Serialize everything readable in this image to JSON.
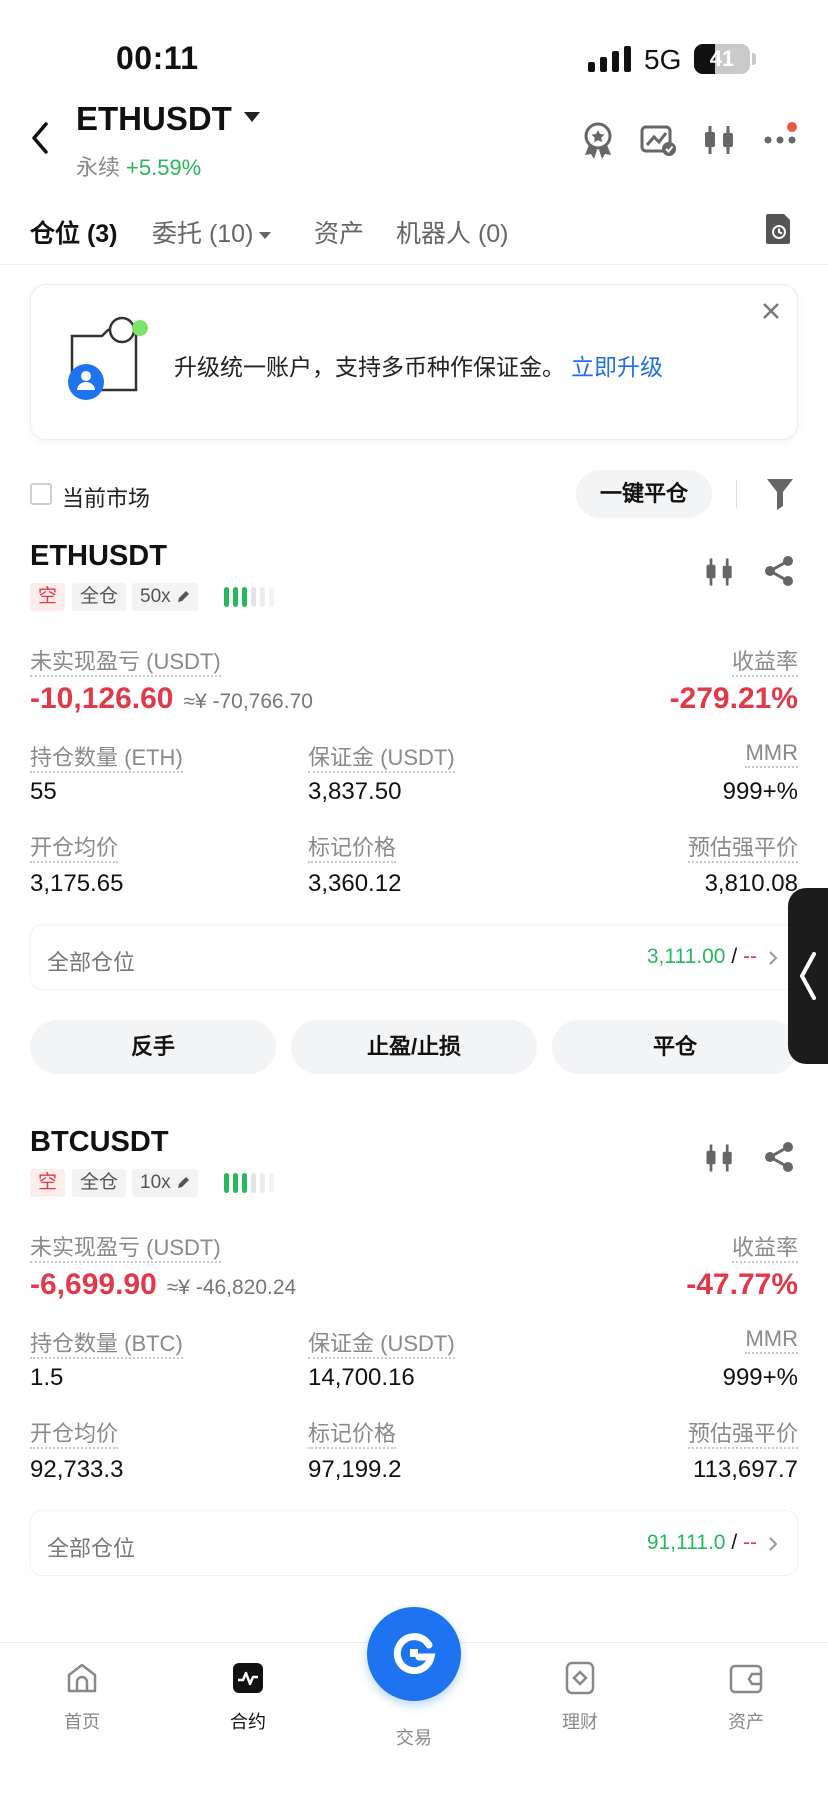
{
  "status_bar": {
    "time": "00:11",
    "network": "5G",
    "battery": "41"
  },
  "header": {
    "symbol": "ETHUSDT",
    "type": "永续",
    "change": "+5.59%"
  },
  "tabs": [
    {
      "label": "仓位 (3)"
    },
    {
      "label": "委托 (10)"
    },
    {
      "label": "资产"
    },
    {
      "label": "机器人 (0)"
    }
  ],
  "banner": {
    "text": "升级统一账户，支持多币种作保证金。",
    "link": "立即升级"
  },
  "filters": {
    "current_market": "当前市场",
    "close_all": "一键平仓"
  },
  "labels": {
    "unrealized_pnl": "未实现盈亏 (USDT)",
    "roe": "收益率",
    "margin": "保证金 (USDT)",
    "mmr": "MMR",
    "entry_price": "开仓均价",
    "mark_price": "标记价格",
    "liq_price": "预估强平价",
    "all_positions": "全部仓位",
    "dashes": "--"
  },
  "positions": [
    {
      "symbol": "ETHUSDT",
      "side": "空",
      "margin_mode": "全仓",
      "leverage": "50x",
      "pnl": "-10,126.60",
      "pnl_cny": "≈¥ -70,766.70",
      "roe": "-279.21%",
      "qty_label": "持仓数量 (ETH)",
      "qty": "55",
      "margin": "3,837.50",
      "mmr": "999+%",
      "entry": "3,175.65",
      "mark": "3,360.12",
      "liq": "3,810.08",
      "tp_price": "3,111.00",
      "sep": "/"
    },
    {
      "symbol": "BTCUSDT",
      "side": "空",
      "margin_mode": "全仓",
      "leverage": "10x",
      "pnl": "-6,699.90",
      "pnl_cny": "≈¥ -46,820.24",
      "roe": "-47.77%",
      "qty_label": "持仓数量 (BTC)",
      "qty": "1.5",
      "margin": "14,700.16",
      "mmr": "999+%",
      "entry": "92,733.3",
      "mark": "97,199.2",
      "liq": "113,697.7",
      "tp_price": "91,111.0",
      "sep": "/"
    }
  ],
  "actions": {
    "reverse": "反手",
    "tpsl": "止盈/止损",
    "close": "平仓"
  },
  "bottom_nav": [
    {
      "label": "首页",
      "icon": "home-icon"
    },
    {
      "label": "合约",
      "icon": "futures-icon"
    },
    {
      "label": "交易",
      "icon": "trade-icon"
    },
    {
      "label": "理财",
      "icon": "earn-icon"
    },
    {
      "label": "资产",
      "icon": "wallet-icon"
    }
  ],
  "colors": {
    "green": "#26b85d",
    "red": "#e2394a",
    "orange": "#f2922c",
    "blue": "#1e74f0"
  }
}
